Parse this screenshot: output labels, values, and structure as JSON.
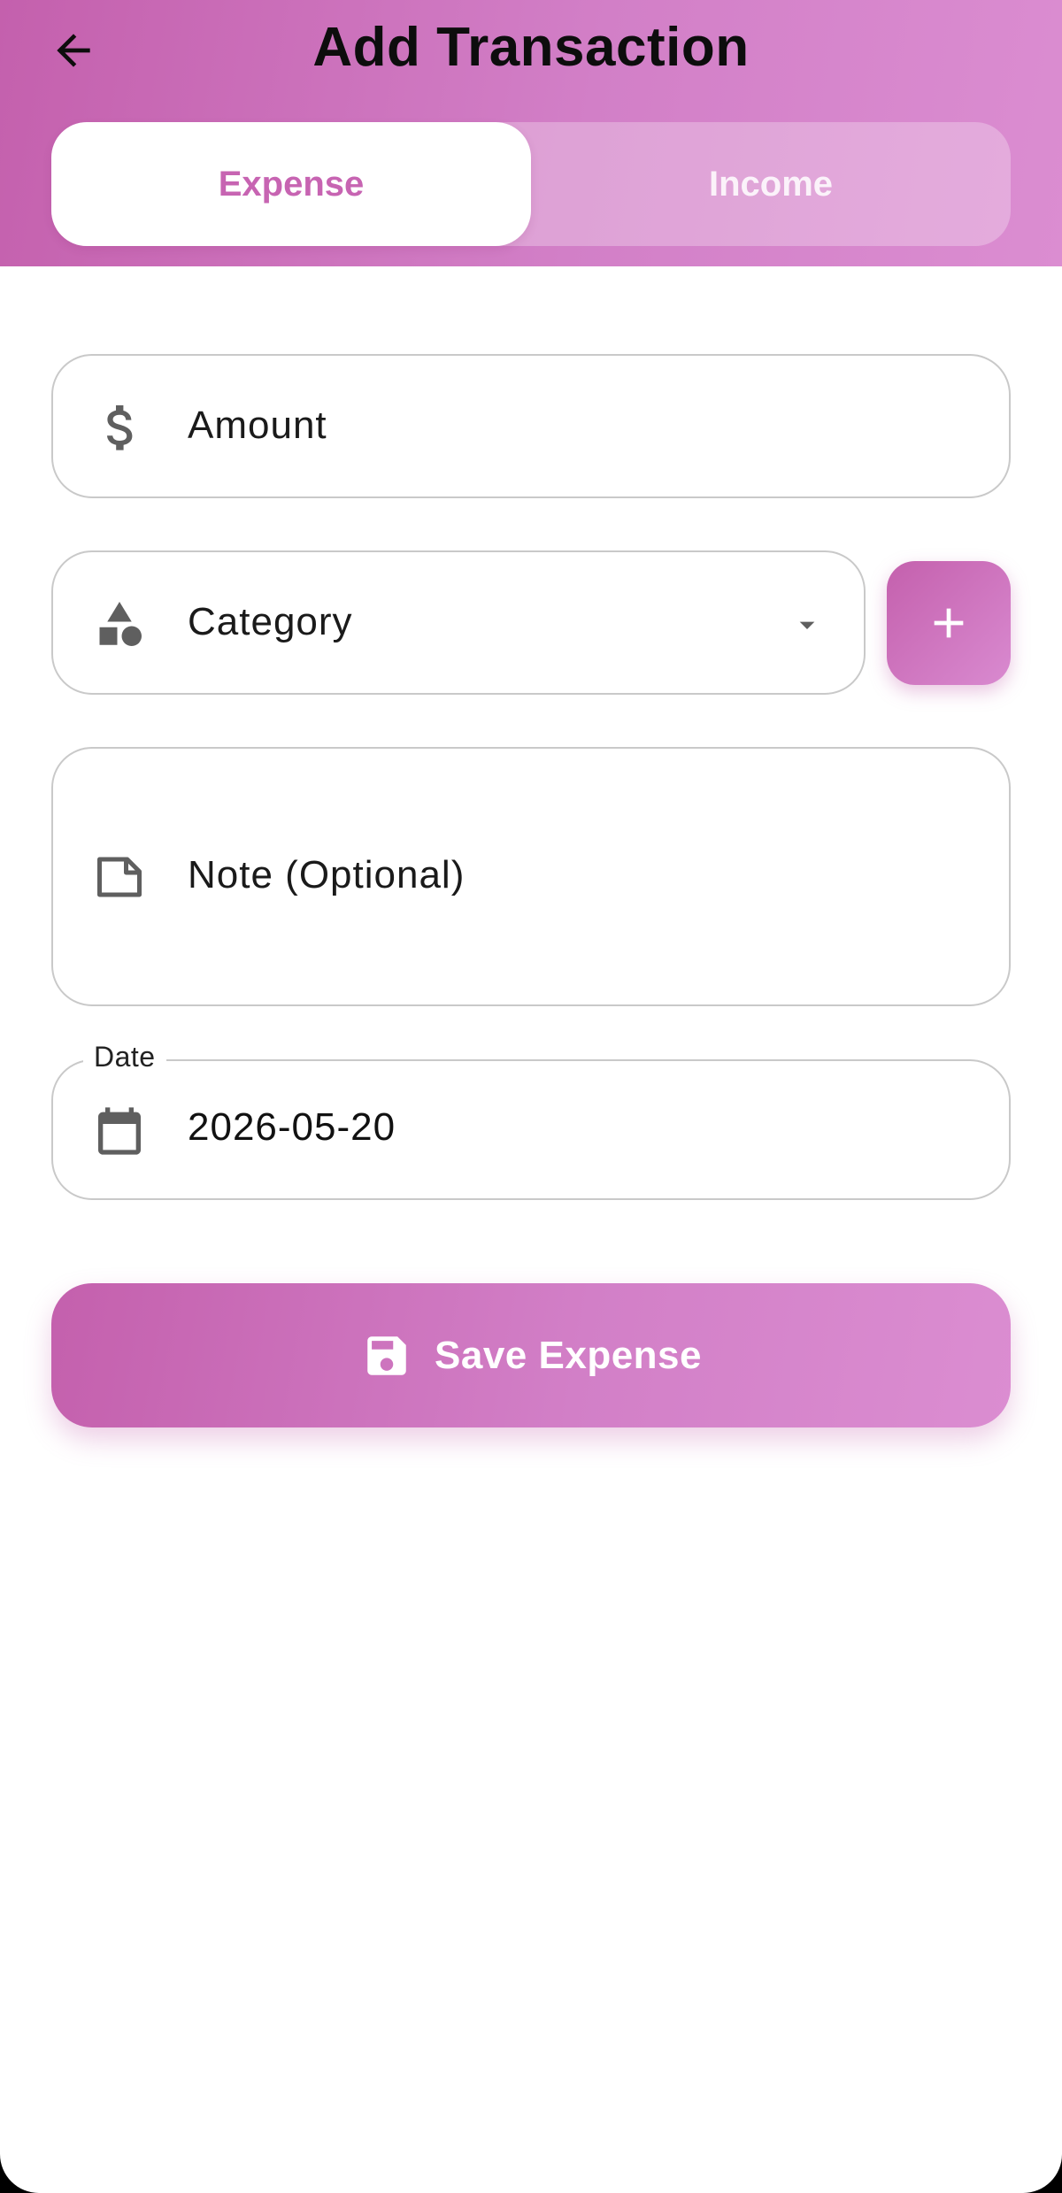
{
  "header": {
    "title": "Add Transaction",
    "back_icon": "arrow-left-icon"
  },
  "type_toggle": {
    "options": [
      {
        "label": "Expense",
        "selected": true
      },
      {
        "label": "Income",
        "selected": false
      }
    ]
  },
  "form": {
    "amount": {
      "placeholder": "Amount",
      "icon": "dollar-icon"
    },
    "category": {
      "placeholder": "Category",
      "icon": "shapes-icon",
      "dropdown_icon": "caret-down-icon"
    },
    "add_category": {
      "icon": "plus-icon"
    },
    "note": {
      "placeholder": "Note (Optional)",
      "icon": "note-icon"
    },
    "date": {
      "label": "Date",
      "value": "2026-05-20",
      "icon": "calendar-icon"
    }
  },
  "save_button": {
    "label": "Save Expense",
    "icon": "save-icon"
  },
  "colors": {
    "accent": "#c764b2",
    "gradient_start": "#c460ad",
    "gradient_end": "#db8dd1"
  }
}
